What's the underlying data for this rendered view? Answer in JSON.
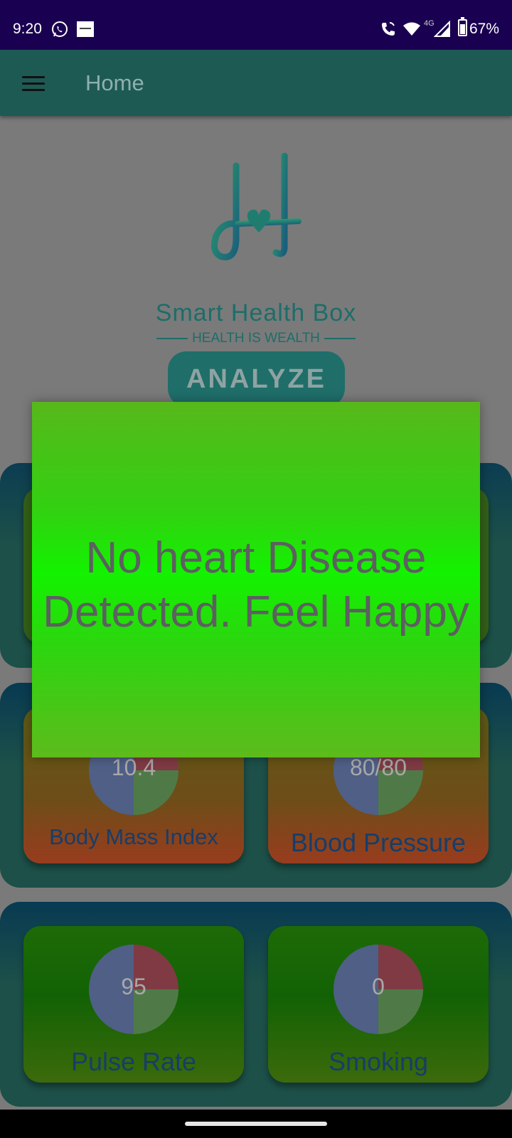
{
  "status_bar": {
    "time": "9:20",
    "network": "4G",
    "battery": "67%",
    "icons": [
      "whatsapp-icon",
      "news-app-icon",
      "wifi-call-icon",
      "wifi-icon",
      "signal-icon",
      "battery-icon"
    ]
  },
  "app_bar": {
    "title": "Home",
    "menu_icon": "hamburger-menu-icon"
  },
  "logo": {
    "name": "Smart Health Box",
    "tagline": "HEALTH IS WEALTH"
  },
  "analyze_button": {
    "label": "ANALYZE"
  },
  "cards": [
    {
      "label": "Body Mass Index",
      "value": "10.4"
    },
    {
      "label": "Blood Pressure",
      "value": "80/80"
    },
    {
      "label": "Pulse Rate",
      "value": "95"
    },
    {
      "label": "Smoking",
      "value": "0"
    }
  ],
  "dialog": {
    "message": "No heart Disease Detected. Feel Happy"
  },
  "colors": {
    "status_bar": "#1a0050",
    "app_bar": "#1e5a54",
    "dialog_green": "#13f200",
    "brand_teal": "#1d6d69"
  }
}
